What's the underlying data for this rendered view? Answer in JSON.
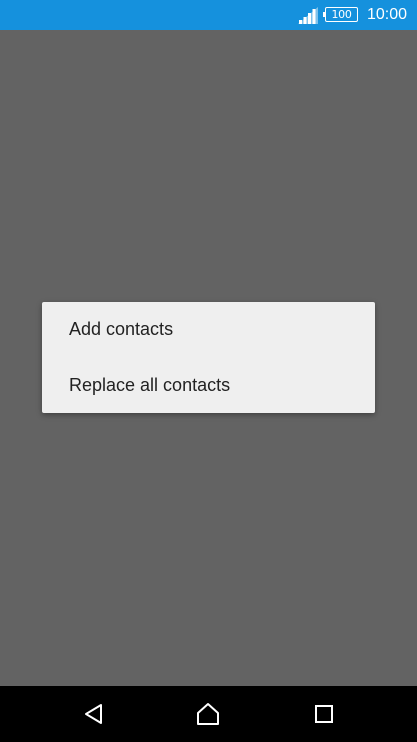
{
  "status_bar": {
    "background": "#1591dd",
    "signal": "signal-icon",
    "battery_level": "100",
    "time": "10:00"
  },
  "dialog": {
    "items": [
      {
        "label": "Add contacts"
      },
      {
        "label": "Replace all contacts"
      }
    ]
  },
  "nav_bar": {
    "buttons": [
      "back-icon",
      "home-icon",
      "recents-icon"
    ]
  }
}
